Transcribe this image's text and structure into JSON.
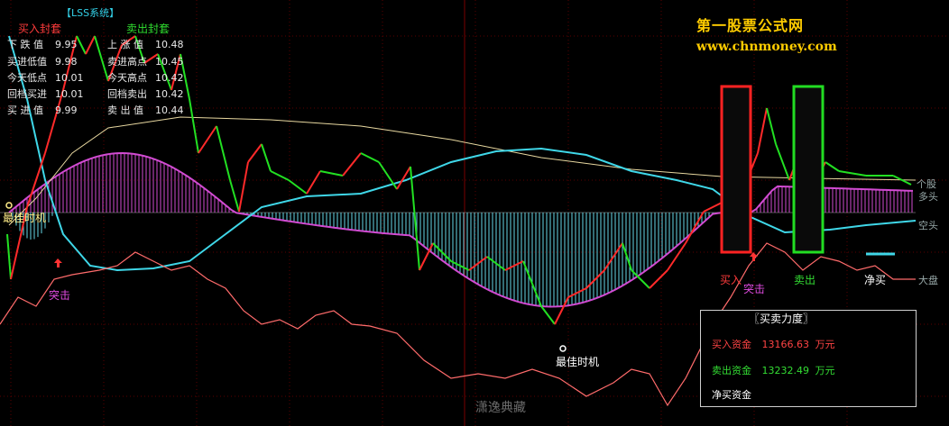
{
  "system_title": "【LSS系统】",
  "buy_header": "买入封套",
  "sell_header": "卖出封套",
  "buy_params": [
    {
      "label": "下 跌 值",
      "value": "9.95"
    },
    {
      "label": "买进低值",
      "value": "9.98"
    },
    {
      "label": "今天低点",
      "value": "10.01"
    },
    {
      "label": "回档买进",
      "value": "10.01"
    },
    {
      "label": "买 进 值",
      "value": "9.99"
    }
  ],
  "sell_params": [
    {
      "label": "上 涨 值",
      "value": "10.48"
    },
    {
      "label": "卖进高点",
      "value": "10.45"
    },
    {
      "label": "今天高点",
      "value": "10.42"
    },
    {
      "label": "回档卖出",
      "value": "10.42"
    },
    {
      "label": "卖 出 值",
      "value": "10.44"
    }
  ],
  "site_name": "第一股票公式网",
  "site_url": "www.chnmoney.com",
  "right_labels": {
    "ge_gu": "个股",
    "duo_tou": "多头",
    "kong_tou": "空头",
    "da_pan": "大盘"
  },
  "signals": {
    "best_time_1": "最佳时机",
    "best_time_2": "最佳时机",
    "attack_1": "突击",
    "attack_2": "突击",
    "buy": "买入",
    "sell": "卖出",
    "net_buy": "净买"
  },
  "force_panel": {
    "title": "〖买卖力度〗",
    "buy_label": "买入资金",
    "buy_value": "13166.63",
    "buy_unit": "万元",
    "sell_label": "卖出资金",
    "sell_value": "13232.49",
    "sell_unit": "万元",
    "net_label": "净买资金"
  },
  "watermark": "潇逸典藏",
  "colors": {
    "price_up": "#ff2a2a",
    "price_down": "#22e022",
    "bull_hist": "#d24bd2",
    "bear_hist": "#66d8e8",
    "envelope": "#d24bd2",
    "cyan_line": "#3fd7e8",
    "yellow_line": "#e8d8a0",
    "market_line": "#ff6b6b",
    "buy_box": "#ff2222",
    "sell_box": "#22dd22"
  },
  "chart_data": {
    "type": "line",
    "series": [
      {
        "name": "个股",
        "values": [
          10.18,
          10.02,
          10.35,
          10.4,
          10.46,
          10.44,
          10.3,
          10.18,
          10.2,
          10.22,
          10.24,
          10.21,
          10.24,
          10.26,
          10.2,
          10.1,
          9.98,
          9.97,
          10.0,
          9.99,
          10.05,
          10.12,
          10.09,
          10.22,
          10.32,
          10.36,
          10.38,
          10.4,
          10.36,
          10.34,
          10.32,
          10.3,
          10.28,
          10.3,
          10.32
        ]
      },
      {
        "name": "大盘",
        "values": [
          0.0,
          0.2,
          0.5,
          0.4,
          0.1,
          -0.5,
          -1.1,
          -1.6,
          -2.0,
          -2.4,
          -2.2,
          -2.8,
          -2.6,
          -2.1,
          -1.5,
          -1.0,
          -0.4,
          0.2,
          0.7,
          0.6,
          0.5
        ]
      },
      {
        "name": "多头",
        "values": [
          0,
          0,
          0,
          0.5,
          1.8,
          2.8,
          3.0,
          3.0,
          2.2,
          1.0,
          -0.5,
          -1.4,
          -1.2,
          -1.1,
          -1.5,
          -2.0,
          -2.4,
          -2.0,
          -1.2,
          0.3,
          1.6,
          2.0,
          1.8,
          1.5
        ]
      },
      {
        "name": "空头",
        "values": [
          0,
          0,
          -0.5,
          -1.5,
          -3.0,
          -3.4,
          -2.5,
          -1.6,
          -0.8,
          0.6,
          2.0,
          2.8,
          2.8,
          2.2,
          1.0,
          -0.6,
          -1.0,
          -0.9,
          -0.8
        ]
      }
    ]
  }
}
